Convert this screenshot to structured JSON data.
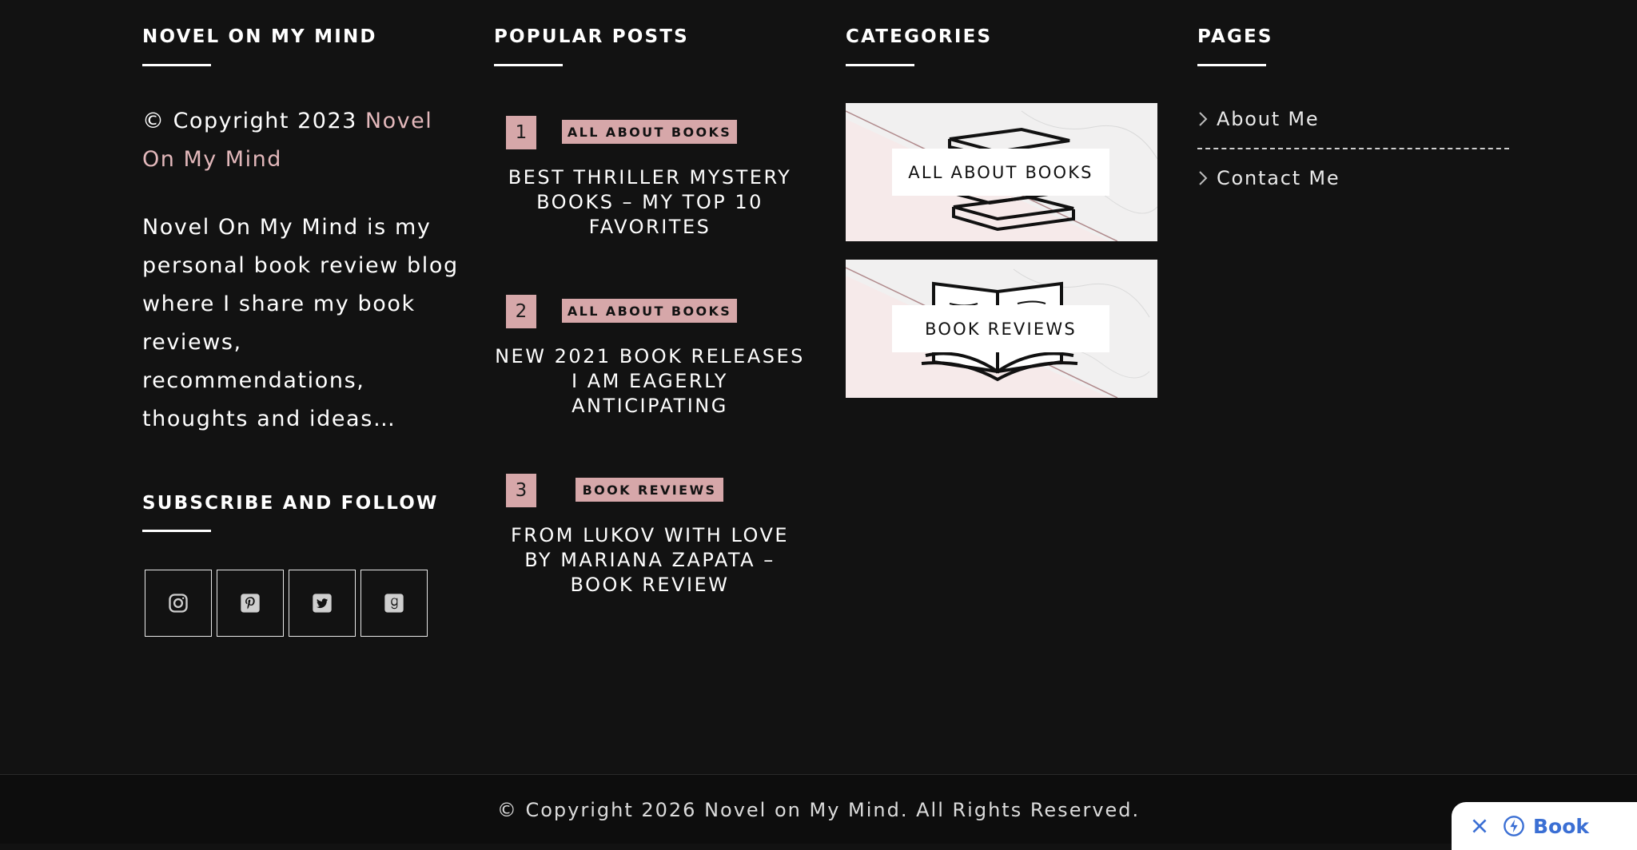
{
  "col1": {
    "title": "NOVEL ON MY MIND",
    "copyright_prefix": "© Copyright 2023 ",
    "copyright_link": "Novel On My Mind",
    "about": "Novel On My Mind is my personal book review blog where I share my book reviews, recommendations, thoughts and ideas…",
    "subscribe_title": "SUBSCRIBE AND FOLLOW",
    "social": [
      {
        "name": "instagram-icon"
      },
      {
        "name": "pinterest-icon"
      },
      {
        "name": "twitter-icon"
      },
      {
        "name": "goodreads-icon"
      }
    ]
  },
  "col2": {
    "title": "POPULAR POSTS",
    "posts": [
      {
        "num": "1",
        "category": "ALL ABOUT BOOKS",
        "title": "BEST THRILLER MYSTERY BOOKS – MY TOP 10 FAVORITES"
      },
      {
        "num": "2",
        "category": "ALL ABOUT BOOKS",
        "title": "NEW 2021 BOOK RELEASES I AM EAGERLY ANTICIPATING"
      },
      {
        "num": "3",
        "category": "BOOK REVIEWS",
        "title": "FROM LUKOV WITH LOVE BY MARIANA ZAPATA – BOOK REVIEW"
      }
    ]
  },
  "col3": {
    "title": "CATEGORIES",
    "cards": [
      {
        "label": "ALL ABOUT BOOKS"
      },
      {
        "label": "BOOK REVIEWS"
      }
    ]
  },
  "col4": {
    "title": "PAGES",
    "links": [
      {
        "label": "About Me"
      },
      {
        "label": "Contact Me"
      }
    ]
  },
  "bottom": {
    "copyright": "© Copyright 2026 Novel on My Mind. All Rights Reserved."
  },
  "widget": {
    "book_label": "Book"
  },
  "colors": {
    "accent_pink": "#d6a7a9",
    "link_pink": "#e3b8bb",
    "background": "#121212",
    "widget_blue": "#3b6fd4"
  }
}
